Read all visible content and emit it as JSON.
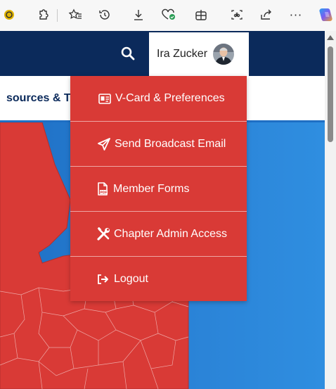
{
  "browser_toolbar": {
    "icons": [
      "reading-view-icon",
      "extensions-icon",
      "favorites-icon",
      "history-icon",
      "downloads-icon",
      "performance-icon",
      "collections-icon",
      "screenshot-icon",
      "share-icon",
      "more-icon",
      "copilot-icon"
    ],
    "more_label": "···"
  },
  "header": {
    "user_name": "Ira Zucker",
    "search_icon": "search-icon",
    "brand_color": "#0b2a5b"
  },
  "nav": {
    "partial_label": "sources & To"
  },
  "user_menu": {
    "background": "#d93a36",
    "items": [
      {
        "icon": "vcard-icon",
        "label": "V-Card & Preferences"
      },
      {
        "icon": "paper-plane-icon",
        "label": "Send Broadcast Email"
      },
      {
        "icon": "pdf-file-icon",
        "label": "Member Forms"
      },
      {
        "icon": "tools-icon",
        "label": "Chapter Admin Access"
      },
      {
        "icon": "logout-icon",
        "label": "Logout"
      }
    ]
  }
}
